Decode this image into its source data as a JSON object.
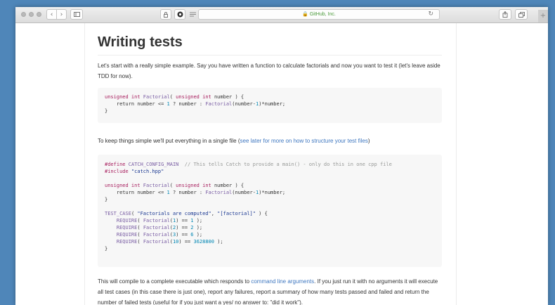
{
  "browser": {
    "address": "GitHub, Inc.",
    "icons": {
      "back": "chevron-left-icon",
      "forward": "chevron-right-icon",
      "sidebar": "sidebar-icon",
      "reload": "reload-icon",
      "share": "share-icon",
      "tabs": "tabs-icon",
      "new_tab": "plus-icon",
      "lock": "lock-icon"
    }
  },
  "page": {
    "heading": "Writing tests",
    "p1": "Let's start with a really simple example. Say you have written a function to calculate factorials and now you want to test it (let's leave aside TDD for now).",
    "p2_before": "To keep things simple we'll put everything in a single file (",
    "p2_link": "see later for more on how to structure your test files",
    "p2_after": ")",
    "p3_before": "This will compile to a complete executable which responds to ",
    "p3_link": "command line arguments",
    "p3_after": ". If you just run it with no arguments it will execute all test cases (in this case there is just one), report any failures, report a summary of how many tests passed and failed and return the number of failed tests (useful for if you just want a yes/ no answer to: \"did it work\")."
  },
  "code1": {
    "l1": {
      "t1": "unsigned int",
      "t2": " ",
      "t3": "Factorial",
      "t4": "( ",
      "t5": "unsigned int",
      "t6": " number ) {"
    },
    "l2": {
      "t1": "    return number <= ",
      "t2": "1",
      "t3": " ? number : ",
      "t4": "Factorial",
      "t5": "(number-",
      "t6": "1",
      "t7": ")*number;"
    },
    "l3": "}"
  },
  "code2": {
    "l1": {
      "t1": "#define",
      "t2": " CATCH_CONFIG_MAIN",
      "t3": "  // This tells Catch to provide a main() - only do this in one cpp file"
    },
    "l2": {
      "t1": "#include",
      "t2": " \"catch.hpp\""
    },
    "l4": {
      "t1": "unsigned int",
      "t2": " ",
      "t3": "Factorial",
      "t4": "( ",
      "t5": "unsigned int",
      "t6": " number ) {"
    },
    "l5": {
      "t1": "    return number <= ",
      "t2": "1",
      "t3": " ? number : ",
      "t4": "Factorial",
      "t5": "(number-",
      "t6": "1",
      "t7": ")*number;"
    },
    "l6": "}",
    "l8": {
      "t1": "TEST_CASE",
      "t2": "( ",
      "t3": "\"Factorials are computed\"",
      "t4": ", ",
      "t5": "\"[factorial]\"",
      "t6": " ) {"
    },
    "r1": {
      "t1": "    ",
      "t2": "REQUIRE",
      "t3": "( ",
      "t4": "Factorial",
      "t5": "(",
      "t6": "1",
      "t7": ") == ",
      "t8": "1",
      "t9": " );"
    },
    "r2": {
      "t1": "    ",
      "t2": "REQUIRE",
      "t3": "( ",
      "t4": "Factorial",
      "t5": "(",
      "t6": "2",
      "t7": ") == ",
      "t8": "2",
      "t9": " );"
    },
    "r3": {
      "t1": "    ",
      "t2": "REQUIRE",
      "t3": "( ",
      "t4": "Factorial",
      "t5": "(",
      "t6": "3",
      "t7": ") == ",
      "t8": "6",
      "t9": " );"
    },
    "r4": {
      "t1": "    ",
      "t2": "REQUIRE",
      "t3": "( ",
      "t4": "Factorial",
      "t5": "(",
      "t6": "10",
      "t7": ") == ",
      "t8": "3628800",
      "t9": " );"
    },
    "l13": "}"
  }
}
